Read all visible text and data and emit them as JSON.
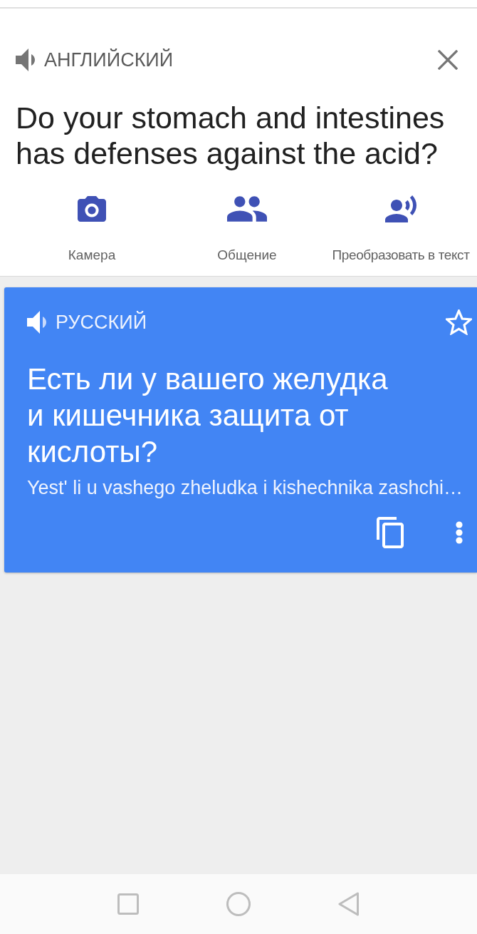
{
  "source": {
    "language": "АНГЛИЙСКИЙ",
    "text": "Do your stomach and intestines has defenses against the acid?"
  },
  "actions": [
    {
      "kind": "camera",
      "label": "Камера"
    },
    {
      "kind": "conversation",
      "label": "Общение"
    },
    {
      "kind": "transcribe",
      "label": "Преобразовать в текст"
    }
  ],
  "translation": {
    "language": "РУССКИЙ",
    "starred": false,
    "text": "Есть ли у вашего желудка и кишечника защита от кислоты?",
    "transliteration": "Yest' li u vashego zheludka i kishechnika zashchi…"
  }
}
